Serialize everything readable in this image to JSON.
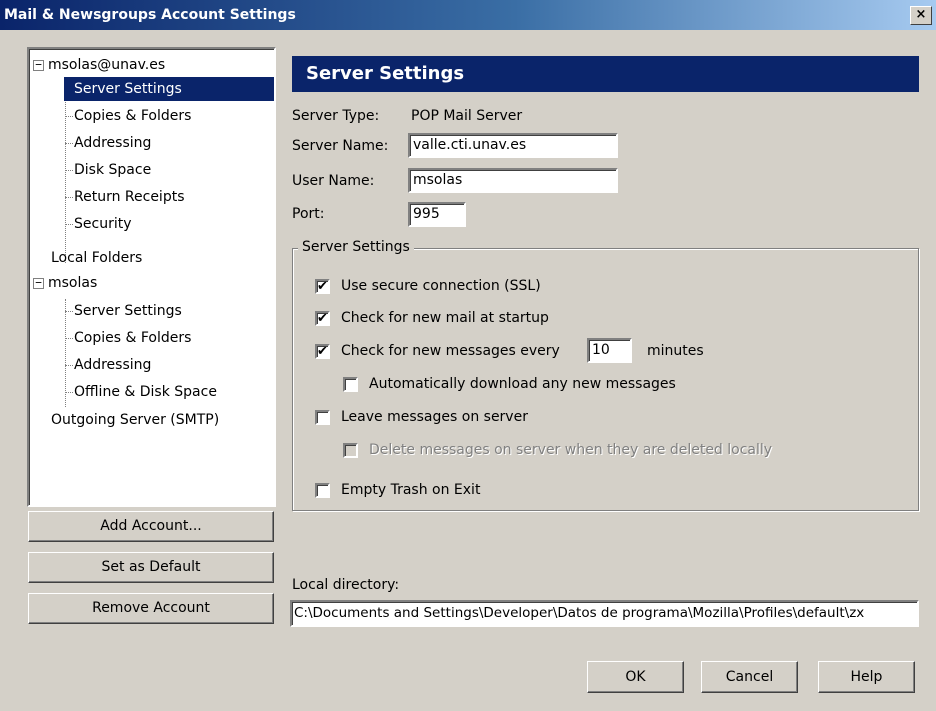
{
  "window": {
    "title": "Mail & Newsgroups Account Settings",
    "close_glyph": "×"
  },
  "tree": {
    "account1": "msolas@unav.es",
    "account1_items": [
      "Server Settings",
      "Copies & Folders",
      "Addressing",
      "Disk Space",
      "Return Receipts",
      "Security"
    ],
    "local_folders": "Local Folders",
    "account2": "msolas",
    "account2_items": [
      "Server Settings",
      "Copies & Folders",
      "Addressing",
      "Offline & Disk Space"
    ],
    "outgoing": "Outgoing Server (SMTP)",
    "expander_glyph": "−"
  },
  "left_buttons": {
    "add": "Add Account...",
    "set_default": "Set as Default",
    "remove": "Remove Account"
  },
  "panel": {
    "header": "Server Settings",
    "server_type_label": "Server Type:",
    "server_type_value": "POP Mail Server",
    "server_name_label": "Server Name:",
    "server_name_value": "valle.cti.unav.es",
    "user_name_label": "User Name:",
    "user_name_value": "msolas",
    "port_label": "Port:",
    "port_value": "995",
    "group_title": "Server Settings",
    "options": {
      "ssl": {
        "label": "Use secure connection (SSL)",
        "checked": true
      },
      "startup": {
        "label": "Check for new mail at startup",
        "checked": true
      },
      "every": {
        "label": "Check for new messages every",
        "checked": true,
        "value": "10",
        "unit": "minutes"
      },
      "autodownload": {
        "label": "Automatically download any new messages",
        "checked": false
      },
      "leave": {
        "label": "Leave messages on server",
        "checked": false
      },
      "delete": {
        "label": "Delete messages on server when they are deleted locally",
        "checked": false,
        "disabled": true
      },
      "empty_trash": {
        "label": "Empty Trash on Exit",
        "checked": false
      }
    },
    "check_glyph": "✔",
    "local_dir_label": "Local directory:",
    "local_dir_value": "C:\\Documents and Settings\\Developer\\Datos de programa\\Mozilla\\Profiles\\default\\zx"
  },
  "dialog_buttons": {
    "ok": "OK",
    "cancel": "Cancel",
    "help": "Help"
  }
}
